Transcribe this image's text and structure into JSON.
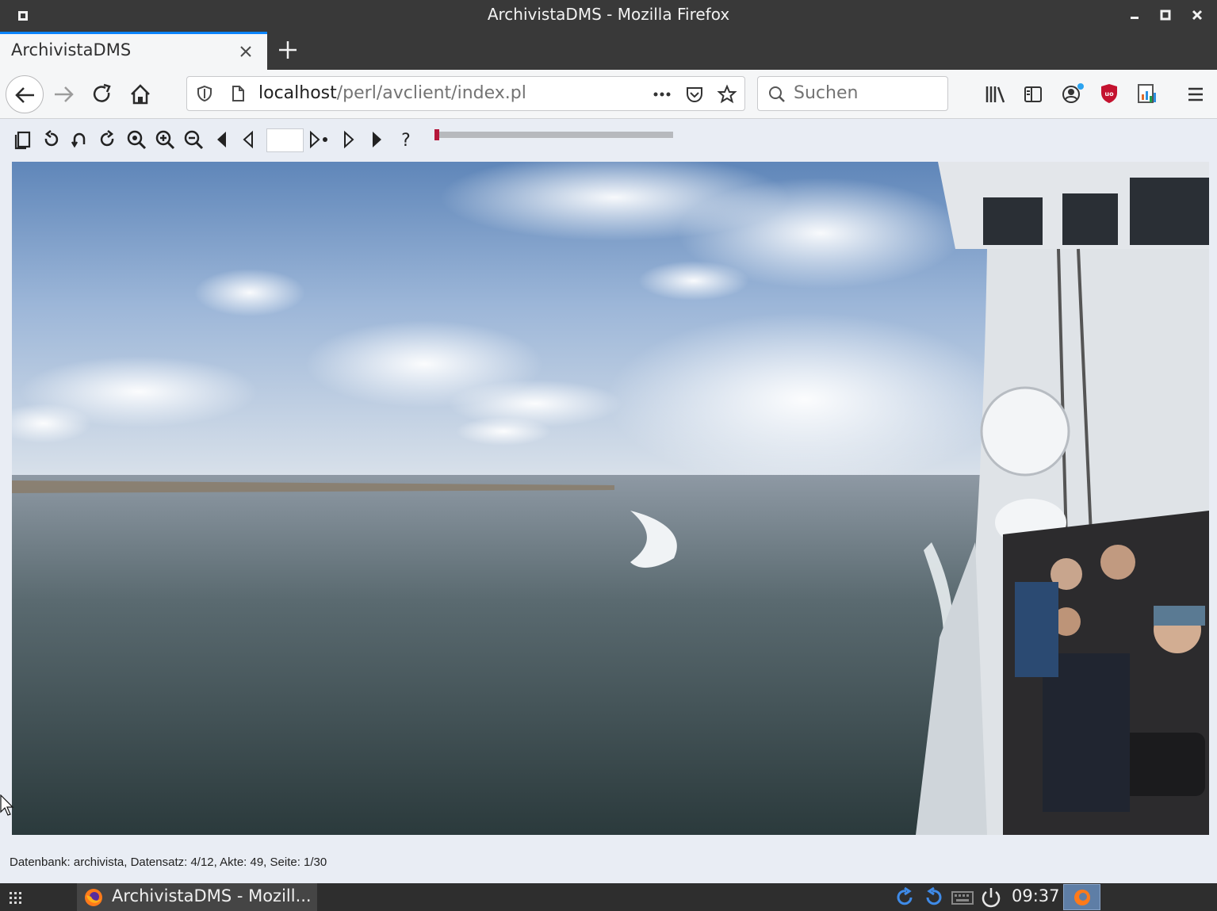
{
  "window": {
    "title": "ArchivistaDMS - Mozilla Firefox"
  },
  "tabs": [
    {
      "label": "ArchivistaDMS"
    }
  ],
  "urlbar": {
    "host": "localhost",
    "path": "/perl/avclient/index.pl"
  },
  "search": {
    "placeholder": "Suchen"
  },
  "viewer": {
    "page_input": "",
    "progress_percent": 2
  },
  "status": {
    "text": "Datenbank: archivista, Datensatz: 4/12, Akte: 49, Seite: 1/30"
  },
  "taskbar": {
    "task_label": "ArchivistaDMS - Mozill...",
    "clock": "09:37"
  },
  "colors": {
    "accent": "#0a84ff",
    "progress": "#b5173a",
    "ublock": "#c4122f"
  }
}
